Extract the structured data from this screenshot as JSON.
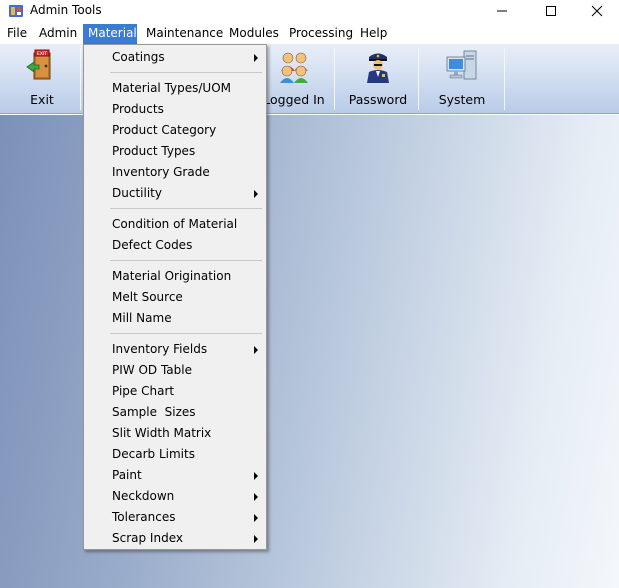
{
  "window": {
    "title": "Admin Tools",
    "icons": [
      "app-icon",
      "minimize-icon",
      "maximize-icon",
      "close-icon"
    ]
  },
  "menubar": {
    "items": [
      {
        "label": "File"
      },
      {
        "label": "Admin"
      },
      {
        "label": "Material",
        "active": true
      },
      {
        "label": "Maintenance"
      },
      {
        "label": "Modules"
      },
      {
        "label": "Processing"
      },
      {
        "label": "Help"
      }
    ]
  },
  "toolbar": {
    "buttons": [
      {
        "label": "Exit",
        "icon": "exit-door-icon"
      },
      {
        "label": "Logged In",
        "icon": "users-icon"
      },
      {
        "label": "Password",
        "icon": "police-officer-icon"
      },
      {
        "label": "System",
        "icon": "computer-icon"
      }
    ]
  },
  "material_menu": {
    "items": [
      "Coatings",
      "Material Types/UOM",
      "Products",
      "Product Category",
      "Product Types",
      "Inventory Grade",
      "Ductility",
      "Condition of Material",
      "Defect Codes",
      "Material Origination",
      "Melt Source",
      "Mill Name",
      "Inventory Fields",
      "PIW OD Table",
      "Pipe Chart",
      "Sample  Sizes",
      "Slit Width Matrix",
      "Decarb Limits",
      "Paint",
      "Neckdown",
      "Tolerances",
      "Scrap Index"
    ],
    "submenu_items": [
      "Coatings",
      "Ductility",
      "Inventory Fields",
      "Paint",
      "Neckdown",
      "Tolerances",
      "Scrap Index"
    ],
    "submenu_arrow_icon": "chevron-right-icon"
  },
  "colors": {
    "menu_highlight": "#3a7bd5",
    "menu_background": "#f0f0f0",
    "toolbar_top": "#e9eff8",
    "toolbar_bottom": "#b9cbe7",
    "client_left": "#7d90b8",
    "client_right": "#f4f7fb"
  }
}
